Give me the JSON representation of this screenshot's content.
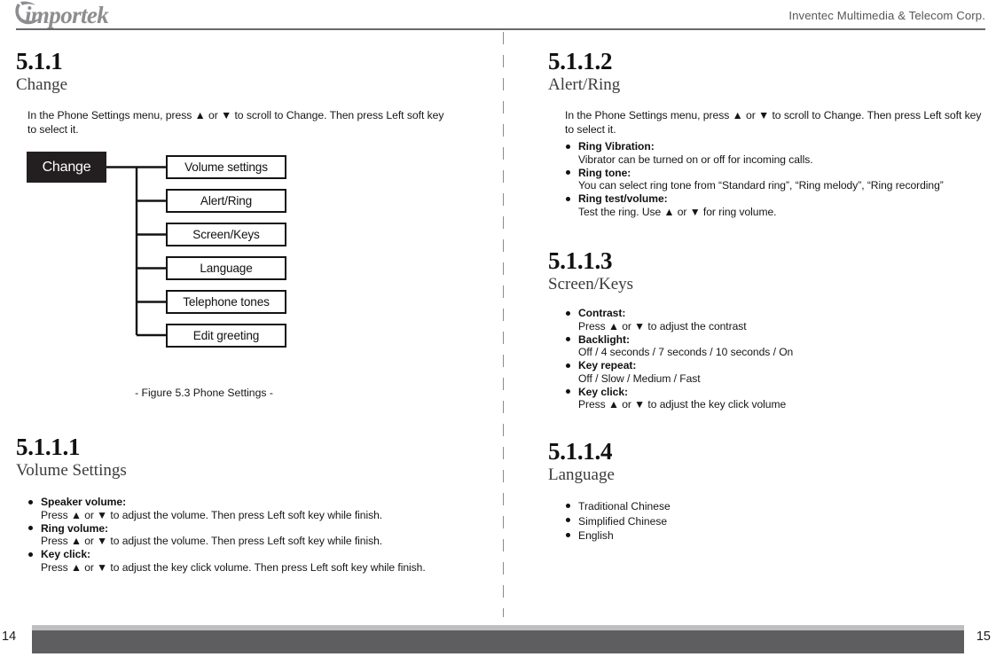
{
  "header": {
    "logo_text": "importek",
    "corp_name": "Inventec Multimedia & Telecom Corp."
  },
  "footer": {
    "page_left": "14",
    "page_right": "15"
  },
  "left_page": {
    "section": {
      "number": "5.1.1",
      "title": "Change"
    },
    "intro": "In the Phone Settings menu, press ▲ or ▼ to scroll to Change. Then press Left soft key to select it.",
    "diagram": {
      "root_label": "Change",
      "nodes": [
        "Volume settings",
        "Alert/Ring",
        "Screen/Keys",
        "Language",
        "Telephone tones",
        "Edit greeting"
      ],
      "caption": "- Figure 5.3 Phone Settings -"
    },
    "subsection": {
      "number": "5.1.1.1",
      "title": "Volume Settings",
      "items": [
        {
          "term": "Speaker volume:",
          "desc": "Press ▲ or ▼ to adjust the volume. Then press Left soft key while finish."
        },
        {
          "term": "Ring volume:",
          "desc": "Press ▲ or ▼ to adjust the volume. Then press Left soft key while finish."
        },
        {
          "term": "Key click:",
          "desc": "Press ▲ or ▼ to adjust the key click volume. Then press Left soft key while finish."
        }
      ]
    }
  },
  "right_page": {
    "section_alert": {
      "number": "5.1.1.2",
      "title": "Alert/Ring",
      "intro": "In the Phone Settings menu, press ▲ or ▼ to scroll to Change. Then press Left soft key to select it.",
      "items": [
        {
          "term": "Ring Vibration:",
          "desc": "Vibrator can be turned on or off for incoming calls."
        },
        {
          "term": "Ring tone:",
          "desc": "You can select ring tone from “Standard ring”, “Ring melody”, “Ring recording”"
        },
        {
          "term": "Ring test/volume:",
          "desc": "Test the ring. Use ▲ or ▼ for ring volume."
        }
      ]
    },
    "section_screen": {
      "number": "5.1.1.3",
      "title": "Screen/Keys",
      "items": [
        {
          "term": "Contrast:",
          "desc": "Press ▲ or ▼ to adjust the contrast"
        },
        {
          "term": "Backlight:",
          "desc": "Off / 4 seconds / 7 seconds / 10 seconds / On"
        },
        {
          "term": "Key repeat:",
          "desc": "Off / Slow / Medium / Fast"
        },
        {
          "term": "Key click:",
          "desc": "Press ▲ or ▼ to adjust the key click volume"
        }
      ]
    },
    "section_language": {
      "number": "5.1.1.4",
      "title": "Language",
      "items": [
        "Traditional Chinese",
        "Simplified Chinese",
        "English"
      ]
    }
  },
  "colors": {
    "root_node_bg": "#231f20",
    "footer_dark": "#5e5d5f",
    "footer_light": "#bebdbf",
    "logo_gray": "#8d8c8f",
    "rule_gray": "#6a696c"
  }
}
